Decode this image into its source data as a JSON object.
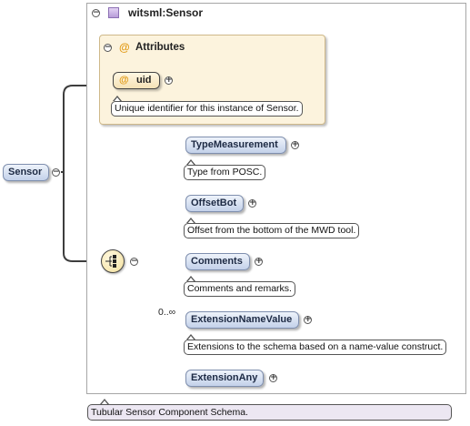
{
  "root": {
    "name": "Sensor",
    "documentation": "Tubular Sensor Component Schema."
  },
  "type": {
    "name": "witsml:Sensor"
  },
  "attributes": {
    "title": "Attributes",
    "items": [
      {
        "name": "uid",
        "documentation": "Unique identifier for this instance of Sensor."
      }
    ]
  },
  "sequence": {
    "elements": [
      {
        "name": "TypeMeasurement",
        "documentation": "Type from POSC.",
        "cardinality": ""
      },
      {
        "name": "OffsetBot",
        "documentation": "Offset from the bottom of the MWD tool.",
        "cardinality": ""
      },
      {
        "name": "Comments",
        "documentation": "Comments and remarks.",
        "cardinality": ""
      },
      {
        "name": "ExtensionNameValue",
        "documentation": "Extensions to the schema based on a name-value construct.",
        "cardinality": "0..∞"
      },
      {
        "name": "ExtensionAny",
        "documentation": "",
        "cardinality": ""
      }
    ]
  },
  "icons": {
    "collapse": "minus-circle-icon",
    "expand": "plus-circle-icon",
    "attribute": "at-sign-icon",
    "type": "complex-type-icon",
    "sequence": "sequence-compositor-icon"
  },
  "colors": {
    "element_fill": "#c3d1ea",
    "attribute_fill": "#fcf3dd",
    "attribute_marker": "#e19a16",
    "type_icon": "#b79cd8",
    "root_doc_fill": "#ece7f2"
  }
}
